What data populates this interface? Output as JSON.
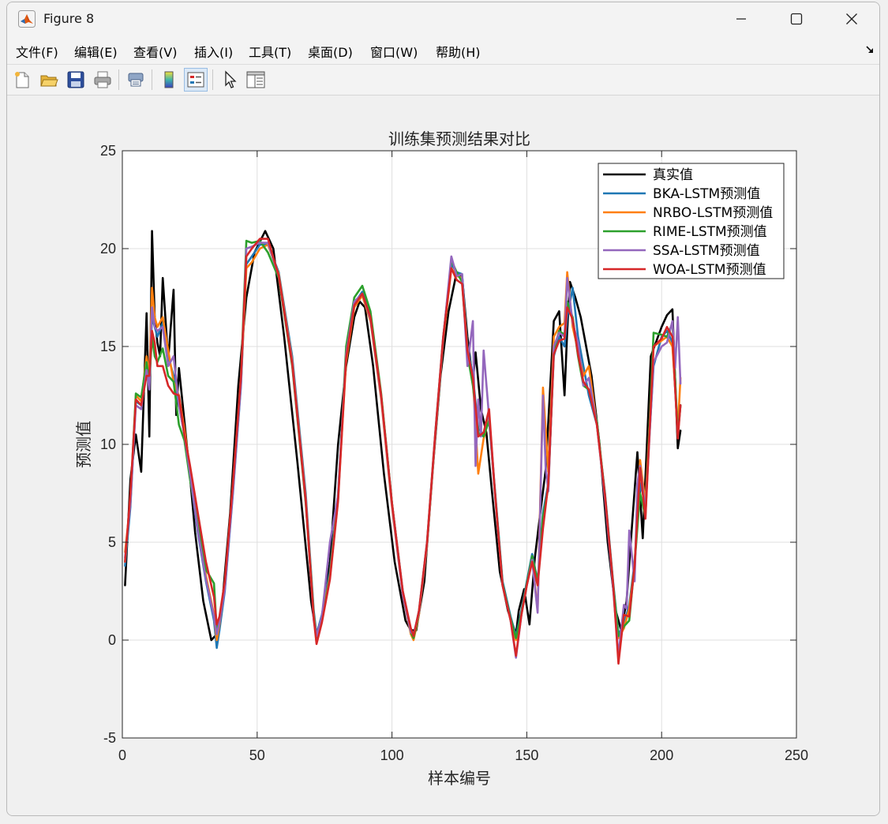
{
  "window": {
    "title": "Figure 8"
  },
  "menu": [
    "文件(F)",
    "编辑(E)",
    "查看(V)",
    "插入(I)",
    "工具(T)",
    "桌面(D)",
    "窗口(W)",
    "帮助(H)"
  ],
  "toolbar": {
    "icons": [
      "new-figure-icon",
      "open-file-icon",
      "save-icon",
      "print-icon",
      "print-preview-icon",
      "colorbar-icon",
      "legend-icon",
      "pointer-icon",
      "property-editor-icon"
    ]
  },
  "colors": {
    "true_value": "#000000",
    "bka": "#1f77b4",
    "nrbo": "#ff7f0e",
    "rime": "#2ca02c",
    "ssa": "#9467bd",
    "woa": "#d62728"
  },
  "chart_data": {
    "type": "line",
    "title": "训练集预测结果对比",
    "xlabel": "样本编号",
    "ylabel": "预测值",
    "xlim": [
      0,
      250
    ],
    "ylim": [
      -5,
      25
    ],
    "xticks": [
      0,
      50,
      100,
      150,
      200,
      250
    ],
    "yticks": [
      -5,
      0,
      5,
      10,
      15,
      20,
      25
    ],
    "grid": true,
    "legend_position": "top-right",
    "series": [
      {
        "name": "真实值",
        "x": [
          1,
          3,
          5,
          7,
          9,
          10,
          11,
          12,
          13,
          14,
          15,
          17,
          19,
          20,
          21,
          23,
          25,
          27,
          30,
          33,
          35,
          37,
          40,
          43,
          46,
          49,
          53,
          56,
          60,
          65,
          70,
          72,
          74,
          77,
          80,
          83,
          86,
          88,
          90,
          93,
          97,
          101,
          105,
          107,
          109,
          112,
          115,
          118,
          121,
          124,
          126,
          128,
          130,
          131,
          133,
          135,
          137,
          140,
          143,
          146,
          147,
          149,
          151,
          153,
          155,
          157,
          160,
          162,
          164,
          165,
          166,
          168,
          170,
          172,
          174,
          177,
          180,
          183,
          185,
          187,
          189,
          191,
          193,
          196,
          200,
          202,
          204,
          206,
          207
        ],
        "y": [
          2.8,
          8.2,
          10.5,
          8.6,
          16.7,
          10.4,
          20.9,
          16.5,
          15.2,
          14.5,
          18.5,
          14.3,
          17.9,
          11.5,
          13.9,
          11.2,
          8.5,
          5.5,
          2.0,
          0.0,
          0.3,
          1.8,
          6.5,
          13.0,
          17.5,
          19.8,
          20.9,
          20.0,
          15.5,
          9.0,
          2.0,
          0.2,
          1.2,
          4.0,
          10.0,
          14.0,
          16.5,
          17.3,
          17.0,
          14.0,
          8.5,
          4.0,
          1.0,
          0.5,
          0.5,
          3.0,
          8.5,
          13.5,
          16.8,
          18.8,
          18.6,
          15.5,
          13.2,
          14.7,
          11.8,
          10.6,
          7.7,
          3.5,
          1.5,
          0.3,
          1.5,
          2.6,
          0.8,
          4.2,
          6.5,
          8.7,
          16.3,
          16.8,
          12.5,
          15.8,
          18.3,
          17.5,
          16.5,
          15.0,
          13.5,
          10.0,
          5.0,
          1.5,
          0.5,
          2.0,
          5.8,
          9.6,
          5.2,
          14.5,
          16.0,
          16.6,
          16.9,
          9.8,
          10.7
        ]
      },
      {
        "name": "BKA-LSTM预测值",
        "x": [
          1,
          3,
          5,
          7,
          9,
          10,
          11,
          12,
          13,
          15,
          17,
          19,
          21,
          23,
          25,
          28,
          31,
          34,
          35,
          36,
          38,
          41,
          44,
          46,
          48,
          51,
          54,
          58,
          63,
          68,
          71,
          72,
          74,
          77,
          80,
          83,
          86,
          89,
          92,
          96,
          100,
          104,
          107,
          108,
          110,
          113,
          116,
          119,
          122,
          124,
          126,
          128,
          130,
          132,
          134,
          136,
          138,
          141,
          144,
          146,
          148,
          150,
          152,
          154,
          156,
          158,
          160,
          162,
          164,
          165,
          167,
          169,
          171,
          173,
          176,
          179,
          182,
          184,
          186,
          188,
          190,
          192,
          194,
          197,
          200,
          202,
          204,
          206,
          207
        ],
        "y": [
          3.8,
          6.8,
          12.2,
          12.0,
          14.0,
          13.0,
          16.5,
          16.0,
          15.5,
          16.2,
          14.5,
          13.5,
          12.0,
          10.5,
          8.5,
          5.5,
          3.0,
          1.0,
          -0.4,
          0.5,
          2.5,
          7.5,
          13.0,
          19.2,
          19.6,
          20.2,
          20.2,
          18.8,
          14.5,
          7.5,
          1.5,
          0.3,
          1.3,
          3.5,
          7.5,
          14.5,
          17.2,
          17.8,
          16.5,
          12.5,
          7.0,
          2.5,
          0.5,
          0.2,
          1.5,
          5.0,
          10.5,
          15.5,
          19.2,
          18.8,
          18.7,
          15.0,
          13.5,
          10.8,
          10.5,
          11.5,
          8.0,
          3.0,
          1.2,
          0.2,
          1.5,
          3.0,
          4.4,
          3.0,
          6.5,
          8.0,
          14.5,
          15.5,
          15.0,
          16.5,
          18.0,
          15.5,
          14.0,
          12.5,
          11.0,
          7.5,
          3.0,
          0.3,
          0.8,
          1.8,
          4.0,
          8.0,
          7.0,
          14.0,
          15.5,
          15.8,
          15.2,
          10.5,
          12.0
        ]
      },
      {
        "name": "NRBO-LSTM预测值",
        "x": [
          1,
          3,
          5,
          7,
          9,
          10,
          11,
          12,
          13,
          15,
          17,
          19,
          21,
          23,
          25,
          28,
          31,
          34,
          35,
          36,
          38,
          41,
          44,
          46,
          48,
          51,
          54,
          58,
          63,
          68,
          71,
          72,
          74,
          77,
          80,
          83,
          86,
          89,
          92,
          96,
          100,
          104,
          107,
          108,
          110,
          113,
          116,
          119,
          122,
          124,
          126,
          128,
          130,
          132,
          134,
          136,
          138,
          141,
          144,
          146,
          148,
          150,
          152,
          154,
          156,
          158,
          160,
          162,
          164,
          165,
          167,
          169,
          171,
          173,
          176,
          179,
          182,
          184,
          186,
          188,
          190,
          192,
          194,
          197,
          200,
          202,
          204,
          206,
          207
        ],
        "y": [
          4.5,
          7.0,
          12.5,
          12.2,
          14.5,
          13.5,
          18.0,
          16.5,
          16.0,
          16.5,
          14.8,
          13.2,
          12.5,
          10.8,
          8.8,
          5.8,
          3.3,
          1.3,
          0.0,
          0.8,
          2.8,
          7.8,
          13.2,
          19.0,
          19.3,
          20.0,
          20.2,
          18.7,
          14.3,
          7.3,
          1.3,
          0.1,
          1.1,
          3.3,
          7.3,
          14.2,
          17.0,
          17.6,
          16.3,
          12.3,
          6.8,
          2.3,
          0.3,
          0.0,
          1.3,
          4.8,
          10.3,
          15.3,
          19.0,
          18.6,
          18.5,
          14.8,
          13.3,
          8.5,
          10.3,
          11.3,
          7.8,
          2.8,
          1.0,
          0.0,
          1.3,
          2.8,
          4.2,
          1.5,
          12.9,
          8.6,
          15.5,
          16.0,
          16.2,
          18.8,
          16.0,
          14.8,
          13.5,
          14.0,
          11.0,
          7.3,
          2.8,
          0.1,
          0.6,
          1.6,
          3.8,
          9.2,
          7.0,
          15.0,
          15.3,
          15.5,
          15.0,
          10.8,
          13.4
        ]
      },
      {
        "name": "RIME-LSTM预测值",
        "x": [
          1,
          3,
          5,
          7,
          9,
          10,
          11,
          12,
          13,
          15,
          17,
          19,
          21,
          23,
          25,
          28,
          31,
          34,
          35,
          36,
          38,
          41,
          44,
          46,
          48,
          51,
          54,
          58,
          63,
          68,
          71,
          72,
          74,
          77,
          80,
          83,
          86,
          89,
          92,
          96,
          100,
          104,
          107,
          108,
          110,
          113,
          116,
          119,
          122,
          124,
          126,
          128,
          130,
          132,
          134,
          136,
          138,
          141,
          144,
          146,
          148,
          150,
          152,
          154,
          156,
          158,
          160,
          162,
          164,
          165,
          167,
          169,
          171,
          173,
          176,
          179,
          182,
          184,
          186,
          188,
          190,
          192,
          194,
          197,
          200,
          202,
          204,
          206,
          207
        ],
        "y": [
          4.0,
          7.2,
          12.6,
          12.4,
          14.2,
          13.2,
          15.5,
          14.5,
          14.2,
          14.9,
          13.5,
          13.2,
          11.0,
          10.2,
          8.3,
          5.9,
          3.6,
          2.9,
          0.5,
          1.0,
          2.9,
          8.0,
          13.5,
          20.4,
          20.3,
          20.4,
          19.8,
          18.5,
          14.0,
          7.0,
          1.2,
          0.0,
          1.0,
          3.2,
          7.2,
          15.0,
          17.5,
          18.1,
          16.8,
          12.6,
          7.0,
          2.4,
          0.4,
          0.1,
          1.4,
          4.9,
          10.4,
          15.4,
          19.4,
          18.8,
          18.3,
          14.6,
          13.0,
          10.6,
          10.4,
          11.2,
          7.9,
          2.9,
          1.1,
          0.1,
          1.4,
          2.9,
          4.3,
          3.0,
          6.3,
          7.8,
          14.8,
          15.8,
          15.6,
          17.3,
          16.5,
          14.5,
          13.0,
          12.8,
          11.2,
          7.4,
          2.9,
          0.2,
          0.7,
          1.0,
          3.9,
          7.5,
          6.3,
          15.7,
          15.6,
          15.5,
          16.2,
          10.5,
          12.0
        ]
      },
      {
        "name": "SSA-LSTM预测值",
        "x": [
          1,
          3,
          5,
          7,
          9,
          10,
          11,
          12,
          13,
          15,
          17,
          19,
          21,
          23,
          25,
          28,
          31,
          34,
          35,
          36,
          38,
          41,
          44,
          46,
          48,
          51,
          54,
          58,
          63,
          68,
          71,
          72,
          74,
          77,
          80,
          83,
          86,
          89,
          92,
          96,
          100,
          104,
          107,
          108,
          110,
          113,
          116,
          119,
          122,
          124,
          126,
          128,
          130,
          131,
          132,
          133,
          134,
          136,
          138,
          141,
          144,
          146,
          148,
          150,
          152,
          154,
          156,
          157,
          158,
          160,
          162,
          164,
          165,
          167,
          169,
          171,
          173,
          176,
          179,
          182,
          184,
          186,
          187,
          188,
          190,
          191,
          192,
          194,
          197,
          200,
          202,
          204,
          205,
          206,
          207
        ],
        "y": [
          4.2,
          7.0,
          12.0,
          11.8,
          13.8,
          12.8,
          17.0,
          16.0,
          15.8,
          16.0,
          14.0,
          14.5,
          12.0,
          10.5,
          8.6,
          5.6,
          3.1,
          1.2,
          0.3,
          0.9,
          2.6,
          7.6,
          13.1,
          20.0,
          20.1,
          20.3,
          20.3,
          18.6,
          14.2,
          7.2,
          1.0,
          0.2,
          1.2,
          5.0,
          7.4,
          14.6,
          17.3,
          17.7,
          16.4,
          12.4,
          6.9,
          2.3,
          0.4,
          0.3,
          1.4,
          4.9,
          10.4,
          15.4,
          19.6,
          18.6,
          18.7,
          14.0,
          16.3,
          8.9,
          12.3,
          10.4,
          14.8,
          11.4,
          7.8,
          2.8,
          1.0,
          -0.9,
          1.3,
          2.8,
          4.1,
          1.4,
          12.5,
          8.8,
          7.6,
          15.0,
          15.7,
          15.5,
          18.5,
          16.2,
          15.2,
          13.0,
          13.4,
          11.0,
          7.2,
          2.7,
          -0.8,
          1.8,
          1.6,
          5.6,
          3.0,
          8.0,
          8.9,
          6.6,
          14.2,
          15.0,
          15.2,
          16.3,
          13.9,
          16.5,
          13.1
        ]
      },
      {
        "name": "WOA-LSTM预测值",
        "x": [
          1,
          3,
          5,
          7,
          9,
          10,
          11,
          12,
          13,
          15,
          17,
          19,
          21,
          23,
          25,
          28,
          31,
          34,
          35,
          36,
          38,
          41,
          44,
          46,
          48,
          51,
          54,
          58,
          63,
          68,
          71,
          72,
          74,
          77,
          80,
          83,
          86,
          89,
          92,
          96,
          100,
          104,
          107,
          108,
          110,
          113,
          116,
          119,
          122,
          124,
          126,
          128,
          130,
          132,
          134,
          136,
          138,
          141,
          144,
          146,
          148,
          150,
          152,
          154,
          156,
          158,
          160,
          162,
          164,
          165,
          167,
          169,
          171,
          173,
          176,
          179,
          182,
          184,
          186,
          188,
          190,
          192,
          194,
          197,
          200,
          202,
          204,
          206,
          207
        ],
        "y": [
          4.0,
          7.5,
          12.3,
          12.0,
          13.5,
          13.5,
          15.8,
          15.2,
          14.0,
          14.0,
          13.0,
          12.6,
          12.5,
          10.5,
          9.0,
          6.5,
          4.0,
          2.2,
          0.8,
          1.2,
          3.0,
          8.0,
          13.5,
          19.6,
          20.0,
          20.5,
          20.5,
          18.6,
          14.1,
          7.1,
          1.1,
          -0.2,
          0.9,
          3.1,
          7.1,
          14.4,
          17.1,
          17.7,
          16.5,
          12.5,
          7.0,
          2.5,
          0.6,
          0.2,
          1.5,
          5.0,
          10.5,
          15.5,
          19.0,
          18.4,
          18.2,
          14.8,
          13.4,
          10.4,
          10.6,
          11.8,
          7.9,
          2.8,
          1.0,
          -0.8,
          1.3,
          2.8,
          4.0,
          2.8,
          5.7,
          8.0,
          14.6,
          15.3,
          15.4,
          17.0,
          16.4,
          14.6,
          13.2,
          12.8,
          11.0,
          7.4,
          2.9,
          -1.2,
          1.3,
          1.2,
          3.8,
          8.8,
          6.2,
          15.0,
          15.4,
          16.0,
          15.5,
          10.3,
          12.0
        ]
      }
    ]
  }
}
